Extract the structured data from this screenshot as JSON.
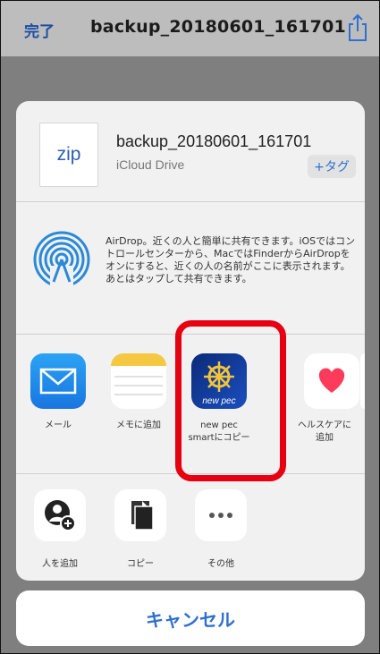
{
  "navbar": {
    "done_label": "完了",
    "title": "backup_20180601_161701"
  },
  "file": {
    "thumb_label": "zip",
    "name": "backup_20180601_161701",
    "location": "iCloud Drive",
    "tag_label": "+タグ"
  },
  "airdrop": {
    "description": "AirDrop。近くの人と簡単に共有できます。iOSではコントロールセンターから、MacではFinderからAirDropをオンにすると、近くの人の名前がここに表示されます。あとはタップして共有できます。"
  },
  "apps": [
    {
      "label": "メール"
    },
    {
      "label": "メモに追加"
    },
    {
      "label": "new pec\nsmartにコピー",
      "tile_text": "new pec"
    },
    {
      "label": "ヘルスケアに\n追加"
    }
  ],
  "actions": [
    {
      "label": "人を追加"
    },
    {
      "label": "コピー"
    },
    {
      "label": "その他"
    }
  ],
  "cancel_label": "キャンセル",
  "colors": {
    "accent": "#2f6fd0",
    "highlight": "#e60012"
  }
}
